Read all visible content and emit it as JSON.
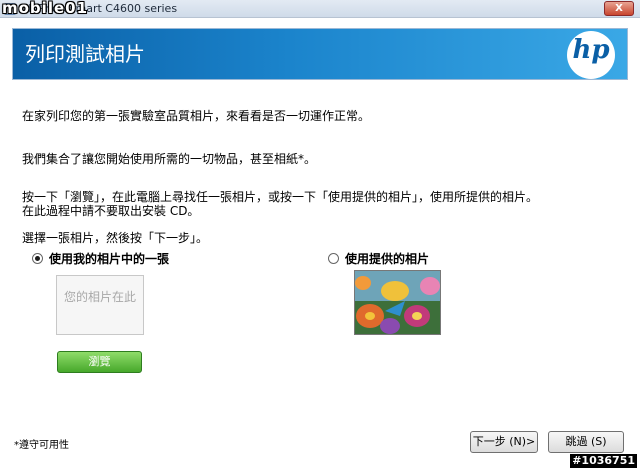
{
  "window": {
    "title": "HP Photosmart C4600 series",
    "close_label": "X",
    "watermark": "mobile01"
  },
  "banner": {
    "title": "列印測試相片",
    "logo_text": "hp"
  },
  "instructions": {
    "line1": "在家列印您的第一張實驗室品質相片，來看看是否一切運作正常。",
    "line2": "我們集合了讓您開始使用所需的一切物品，甚至相紙*。",
    "line3a": "按一下「瀏覽」，在此電腦上尋找任一張相片，或按一下「使用提供的相片」，使用所提供的相片。",
    "line3b": "在此過程中請不要取出安裝 CD。",
    "line4": "選擇一張相片，然後按「下一步」。"
  },
  "options": {
    "mine": {
      "label": "使用我的相片中的一張",
      "selected": true
    },
    "provided": {
      "label": "使用提供的相片",
      "selected": false
    }
  },
  "placeholder": {
    "text": "您的相片在此"
  },
  "buttons": {
    "browse": "瀏覽",
    "next": "下一步 (N)>",
    "skip": "跳過 (S)"
  },
  "footnote": "*遵守可用性",
  "image_id": "#1036751",
  "colors": {
    "banner": "#1b84cc",
    "browse": "#47a82b"
  }
}
